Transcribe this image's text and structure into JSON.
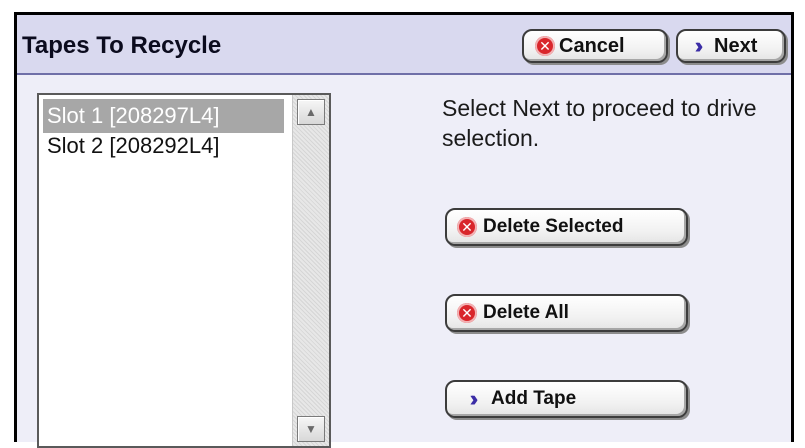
{
  "panel": {
    "title": "Tapes To Recycle",
    "cancel_label": "Cancel",
    "next_label": "Next"
  },
  "tape_list": {
    "items": [
      {
        "label": "Slot 1 [208297L4]",
        "selected": true
      },
      {
        "label": "Slot 2 [208292L4]",
        "selected": false
      }
    ]
  },
  "instructions": "Select Next to proceed to drive selection.",
  "actions": {
    "delete_selected_label": "Delete Selected",
    "delete_all_label": "Delete All",
    "add_tape_label": "Add Tape"
  },
  "icons": {
    "cancel": "cancel-circle-icon",
    "next": "double-chevron-right-icon"
  },
  "colors": {
    "cancel_icon": "#d9262b",
    "next_icon": "#3b2da6",
    "selection": "#a7a7a7",
    "title_bar": "#d9d9ef"
  }
}
